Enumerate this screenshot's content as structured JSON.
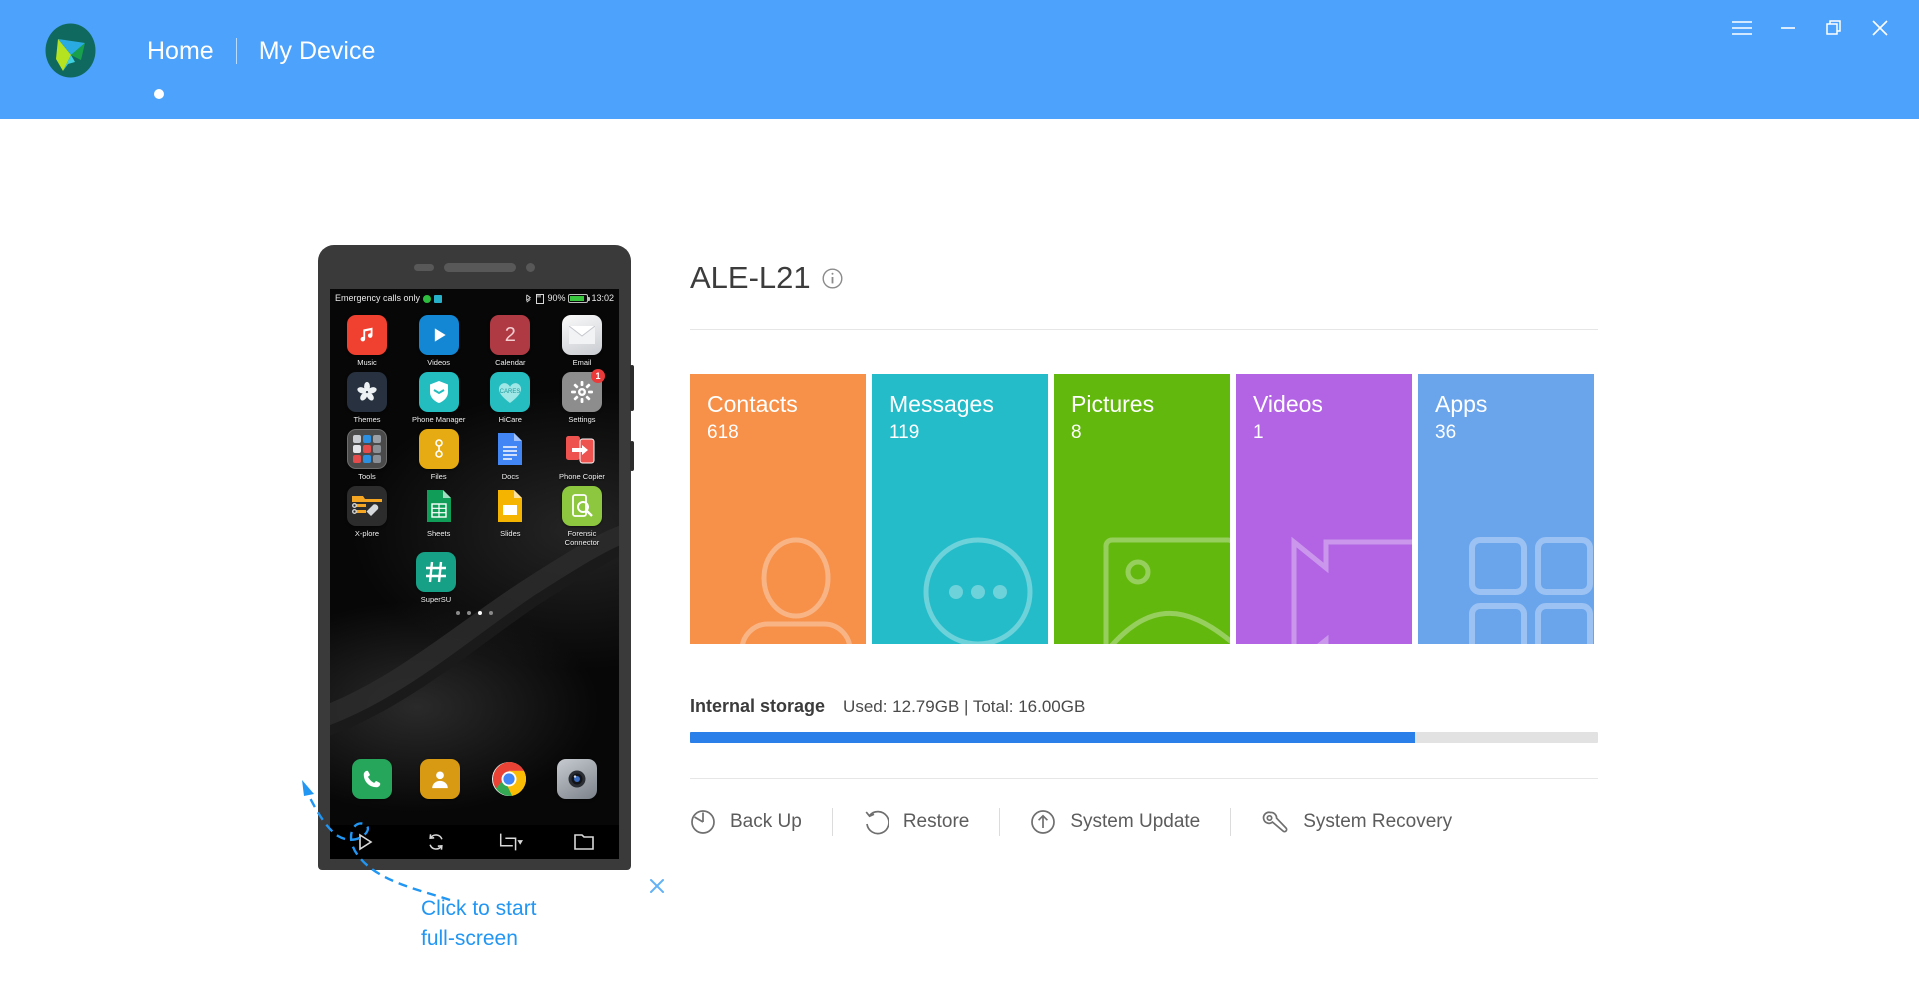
{
  "titlebar": {
    "logo_icon": "app-logo-icon",
    "nav": [
      {
        "label": "Home",
        "active": true
      },
      {
        "label": "My Device",
        "active": false
      }
    ],
    "window_controls": [
      {
        "name": "menu-icon",
        "label": "Menu"
      },
      {
        "name": "minimize-icon",
        "label": "Minimize"
      },
      {
        "name": "restore-icon",
        "label": "Restore"
      },
      {
        "name": "close-icon",
        "label": "Close"
      }
    ],
    "background_color": "#4da2fb"
  },
  "phone": {
    "status_bar": {
      "carrier": "Emergency calls only",
      "battery_percent": "90%",
      "time": "13:02"
    },
    "apps": [
      [
        {
          "label": "Music",
          "icon": "music-note-icon",
          "color": "#f0402f"
        },
        {
          "label": "Videos",
          "icon": "play-icon",
          "color": "#1487d4"
        },
        {
          "label": "Calendar",
          "icon": "calendar-icon",
          "color": "#b03a44",
          "glyph": "2"
        },
        {
          "label": "Email",
          "icon": "envelope-icon",
          "color": "#e9e9ea"
        }
      ],
      [
        {
          "label": "Themes",
          "icon": "flower-icon",
          "color": "#27313f"
        },
        {
          "label": "Phone Manager",
          "icon": "shield-icon",
          "color": "#23bcbf"
        },
        {
          "label": "HiCare",
          "icon": "heart-icon",
          "color": "#26bdc0",
          "glyph": "CARES"
        },
        {
          "label": "Settings",
          "icon": "gear-icon",
          "color": "#8d8d8d",
          "badge": "1"
        }
      ],
      [
        {
          "label": "Tools",
          "icon": "folder-group-icon",
          "color": "#4a4a4a"
        },
        {
          "label": "Files",
          "icon": "files-icon",
          "color": "#e6ab12"
        },
        {
          "label": "Docs",
          "icon": "document-icon",
          "color": "#3a86f0"
        },
        {
          "label": "Phone Copier",
          "icon": "phone-copy-icon",
          "color": "#ed4f58"
        }
      ],
      [
        {
          "label": "X-plore",
          "icon": "wrench-folder-icon",
          "color": "#2c2c2c"
        },
        {
          "label": "Sheets",
          "icon": "spreadsheet-icon",
          "color": "#1da462"
        },
        {
          "label": "Slides",
          "icon": "slides-icon",
          "color": "#f2b01e"
        },
        {
          "label": "Forensic Connector",
          "icon": "magnifier-phone-icon",
          "color": "#8dc63f"
        }
      ],
      [
        {
          "label": "SuperSU",
          "icon": "hash-icon",
          "color": "#16a085"
        }
      ]
    ],
    "page_dots": {
      "count": 4,
      "active_index": 2
    },
    "dock": [
      {
        "label": "Phone",
        "icon": "phone-icon",
        "color": "#26a65b"
      },
      {
        "label": "Contacts",
        "icon": "person-icon",
        "color": "#d79a12"
      },
      {
        "label": "Chrome",
        "icon": "chrome-icon",
        "color": "#ffffff"
      },
      {
        "label": "Camera",
        "icon": "camera-icon",
        "color": "#8e9299"
      }
    ],
    "toolbar": [
      {
        "name": "fullscreen-play-button",
        "icon": "play-triangle-icon"
      },
      {
        "name": "refresh-button",
        "icon": "refresh-icon"
      },
      {
        "name": "screenshot-crop-button",
        "icon": "crop-dropdown-icon"
      },
      {
        "name": "folder-button",
        "icon": "folder-icon"
      }
    ]
  },
  "annotation": {
    "text_line1": "Click to start",
    "text_line2": "full-screen",
    "color": "#2196f3",
    "close_icon": "close-icon"
  },
  "device": {
    "name": "ALE-L21",
    "info_icon": "info-circle-icon"
  },
  "tiles": [
    {
      "title": "Contacts",
      "count": "618",
      "color": "#f79049",
      "art": "person-outline-icon"
    },
    {
      "title": "Messages",
      "count": "119",
      "color": "#25bcc9",
      "art": "chat-bubble-icon"
    },
    {
      "title": "Pictures",
      "count": "8",
      "color": "#63b80d",
      "art": "photo-frame-icon"
    },
    {
      "title": "Videos",
      "count": "1",
      "color": "#b264e4",
      "art": "film-icon"
    },
    {
      "title": "Apps",
      "count": "36",
      "color": "#6aa5ec",
      "art": "grid-icon"
    }
  ],
  "storage": {
    "label": "Internal storage",
    "values": "Used: 12.79GB | Total: 16.00GB",
    "used_percent": 79.9,
    "bar_color": "#2a7fe8"
  },
  "actions": [
    {
      "label": "Back Up",
      "icon": "backup-pie-icon"
    },
    {
      "label": "Restore",
      "icon": "restore-arrow-icon"
    },
    {
      "label": "System Update",
      "icon": "upload-circle-icon"
    },
    {
      "label": "System Recovery",
      "icon": "wrench-icon"
    }
  ]
}
